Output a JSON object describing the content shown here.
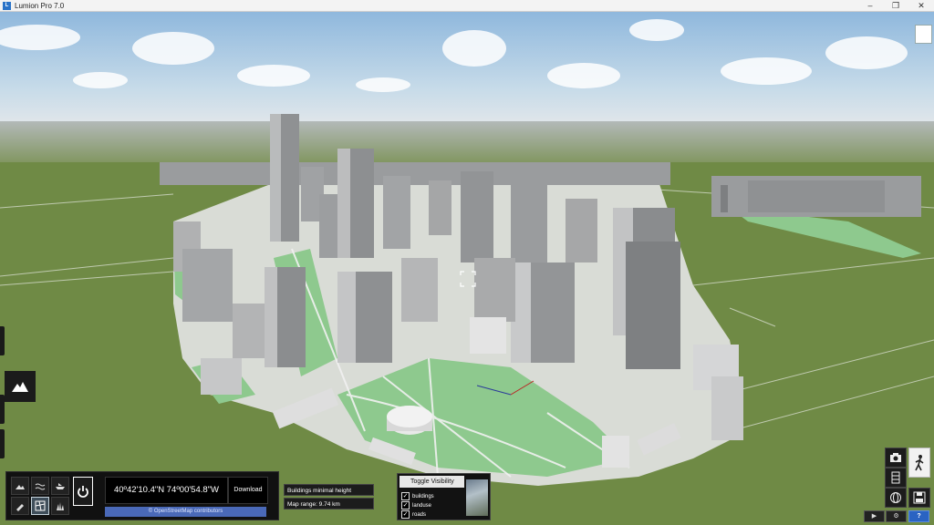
{
  "window": {
    "title": "Lumion Pro 7.0",
    "minimize": "–",
    "maximize": "❐",
    "close": "✕"
  },
  "location": {
    "coordinates": "40º42'10.4\"N 74º00'54.8\"W",
    "download_label": "Download",
    "credit": "© OpenStreetMap contributors"
  },
  "settings": {
    "buildings_mode": "Buildings minimal height",
    "map_range": "Map range: 9.74 km"
  },
  "visibility": {
    "title": "Toggle Visibility",
    "items": [
      {
        "label": "buildings",
        "checked": true
      },
      {
        "label": "landuse",
        "checked": true
      },
      {
        "label": "roads",
        "checked": true
      }
    ]
  },
  "icons": {
    "power": "power-icon",
    "terrain": "mountain-icon",
    "camera": "camera-icon",
    "movie": "film-icon",
    "panorama": "globe-icon",
    "walk": "walking-person-icon",
    "save": "floppy-disk-icon"
  },
  "bottom_buttons": {
    "play": "▶",
    "settings": "⚙",
    "help": "?"
  },
  "colors": {
    "grass": "#6f8a45",
    "park": "#8ec98e",
    "building": "#b8b8b8",
    "sky": "#a9c9e3"
  }
}
